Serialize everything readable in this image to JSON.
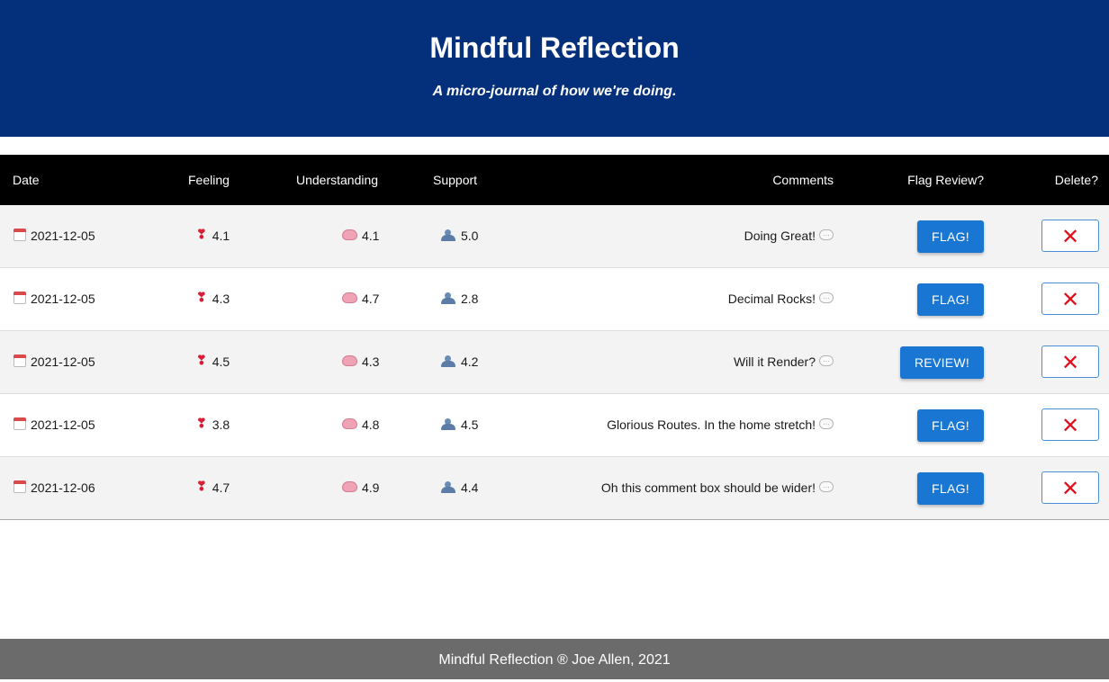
{
  "header": {
    "title": "Mindful Reflection",
    "subtitle": "A micro-journal of how we're doing."
  },
  "columns": {
    "date": "Date",
    "feeling": "Feeling",
    "understanding": "Understanding",
    "support": "Support",
    "comments": "Comments",
    "flag_review": "Flag Review?",
    "delete": "Delete?"
  },
  "rows": [
    {
      "date": "2021-12-05",
      "feeling": "4.1",
      "understanding": "4.1",
      "support": "5.0",
      "comment": "Doing Great!",
      "action": "FLAG!"
    },
    {
      "date": "2021-12-05",
      "feeling": "4.3",
      "understanding": "4.7",
      "support": "2.8",
      "comment": "Decimal Rocks!",
      "action": "FLAG!"
    },
    {
      "date": "2021-12-05",
      "feeling": "4.5",
      "understanding": "4.3",
      "support": "4.2",
      "comment": "Will it Render?",
      "action": "REVIEW!"
    },
    {
      "date": "2021-12-05",
      "feeling": "3.8",
      "understanding": "4.8",
      "support": "4.5",
      "comment": "Glorious Routes. In the home stretch!",
      "action": "FLAG!"
    },
    {
      "date": "2021-12-06",
      "feeling": "4.7",
      "understanding": "4.9",
      "support": "4.4",
      "comment": "Oh this comment box should be wider!",
      "action": "FLAG!"
    }
  ],
  "icons": {
    "date": "calendar-icon",
    "feeling": "heart-exclamation-icon",
    "understanding": "brain-icon",
    "support": "people-icon",
    "comment": "speech-bubble-icon",
    "delete": "cross-mark-icon"
  },
  "delete_glyph": "✕",
  "colors": {
    "header_bg": "#042f7a",
    "table_header_bg": "#000000",
    "button": "#1976d2",
    "delete_x": "#e0101d",
    "footer_bg": "#6b6b6b"
  },
  "footer": {
    "text": "Mindful Reflection ® Joe Allen, 2021"
  }
}
